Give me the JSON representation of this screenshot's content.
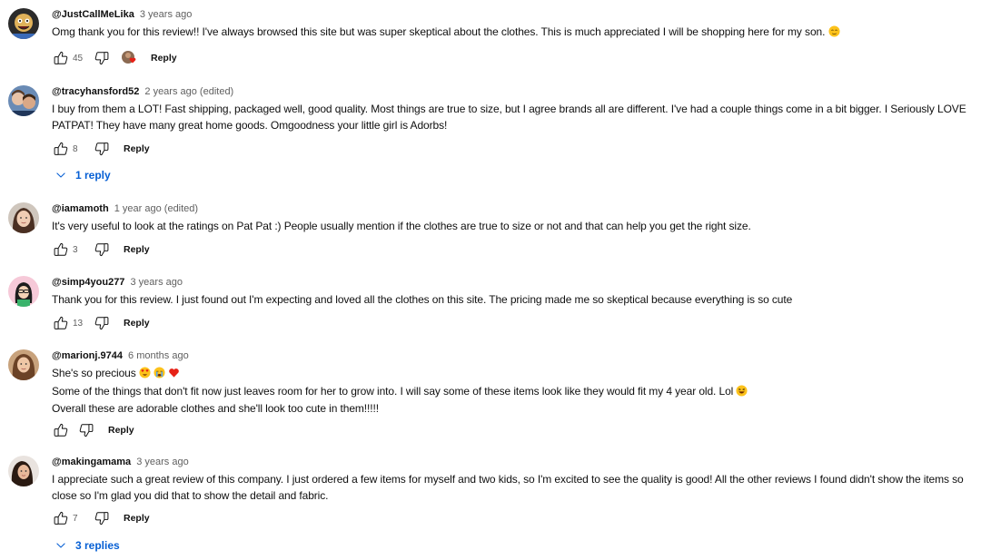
{
  "comments": [
    {
      "handle": "@JustCallMeLika",
      "time": "3 years ago",
      "lines": [
        "Omg thank you for this review!! I've always browsed this site but was super skeptical about the clothes. This is much appreciated I will be shopping here for my son."
      ],
      "likes": "45",
      "reply_label": "Reply"
    },
    {
      "handle": "@tracyhansford52",
      "time": "2 years ago (edited)",
      "lines": [
        "I buy from them a LOT!  Fast shipping, packaged well, good quality.  Most things are true to size, but I agree brands all are different.  I've had a couple things come in a bit bigger.  I Seriously LOVE PATPAT!  They have many great home goods.  Omgoodness your little girl is Adorbs!"
      ],
      "likes": "8",
      "reply_label": "Reply",
      "replies": "1 reply"
    },
    {
      "handle": "@iamamoth",
      "time": "1 year ago (edited)",
      "lines": [
        "It's very useful to look at the ratings on Pat Pat :) People usually mention if the clothes are true to size or not and that can help you get the right size."
      ],
      "likes": "3",
      "reply_label": "Reply"
    },
    {
      "handle": "@simp4you277",
      "time": "3 years ago",
      "lines": [
        "Thank you for this review. I just found out I'm expecting and loved all the clothes on this site. The pricing made me so skeptical because everything is so cute"
      ],
      "likes": "13",
      "reply_label": "Reply"
    },
    {
      "handle": "@marionj.9744",
      "time": "6 months ago",
      "lines": [
        "She's so precious",
        "Some of the things that don't fit now just leaves room for her to grow into. I will say some of these items look like they would fit my 4 year old. Lol",
        "Overall these are adorable clothes and she'll look too cute in them!!!!!"
      ],
      "likes": "",
      "reply_label": "Reply"
    },
    {
      "handle": "@makingamama",
      "time": "3 years ago",
      "lines": [
        "I appreciate such a great review of this company. I just ordered a few items for myself and two kids, so I'm excited to see the quality is good! All the other reviews I found didn't show the items so close so I'm glad you did that to show the detail and fabric."
      ],
      "likes": "7",
      "reply_label": "Reply",
      "replies": "3 replies"
    }
  ],
  "icons": {
    "like": "thumbs-up-icon",
    "dislike": "thumbs-down-icon",
    "creator_heart": "creator-heart-icon",
    "expand": "chevron-down-icon"
  },
  "colors": {
    "link_blue": "#065fd4",
    "meta_gray": "#606060",
    "heart_red": "#e62117"
  }
}
